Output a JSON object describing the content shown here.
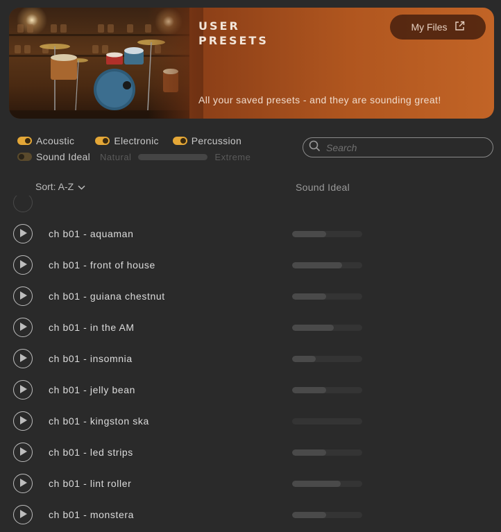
{
  "banner": {
    "title": "USER PRESETS",
    "subtitle": "All your saved presets - and they are sounding great!",
    "my_files_label": "My Files"
  },
  "filters": {
    "categories": [
      {
        "label": "Acoustic",
        "enabled": true
      },
      {
        "label": "Electronic",
        "enabled": true
      },
      {
        "label": "Percussion",
        "enabled": true
      }
    ],
    "sound_ideal": {
      "label": "Sound Ideal",
      "enabled": false,
      "min_label": "Natural",
      "max_label": "Extreme"
    }
  },
  "search": {
    "placeholder": "Search",
    "value": ""
  },
  "list_header": {
    "sort_label": "Sort: A-Z",
    "column_label": "Sound Ideal"
  },
  "presets": [
    {
      "name": "ch b01 - aquaman",
      "sound_ideal": 0.49
    },
    {
      "name": "ch b01 - front of house",
      "sound_ideal": 0.71
    },
    {
      "name": "ch b01 - guiana chestnut",
      "sound_ideal": 0.49
    },
    {
      "name": "ch b01 - in the AM",
      "sound_ideal": 0.59
    },
    {
      "name": "ch b01 - insomnia",
      "sound_ideal": 0.34
    },
    {
      "name": "ch b01 - jelly bean",
      "sound_ideal": 0.49
    },
    {
      "name": "ch b01 - kingston ska",
      "sound_ideal": 0.0
    },
    {
      "name": "ch b01 - led strips",
      "sound_ideal": 0.49
    },
    {
      "name": "ch b01 - lint roller",
      "sound_ideal": 0.69
    },
    {
      "name": "ch b01 - monstera",
      "sound_ideal": 0.49
    }
  ],
  "colors": {
    "accent": "#e4a737",
    "background": "#2a2a2a",
    "banner": "#b0561f"
  },
  "icons": {
    "my_files": "external-link-icon",
    "search": "search-icon",
    "sort": "chevron-down-icon",
    "play": "play-icon"
  }
}
